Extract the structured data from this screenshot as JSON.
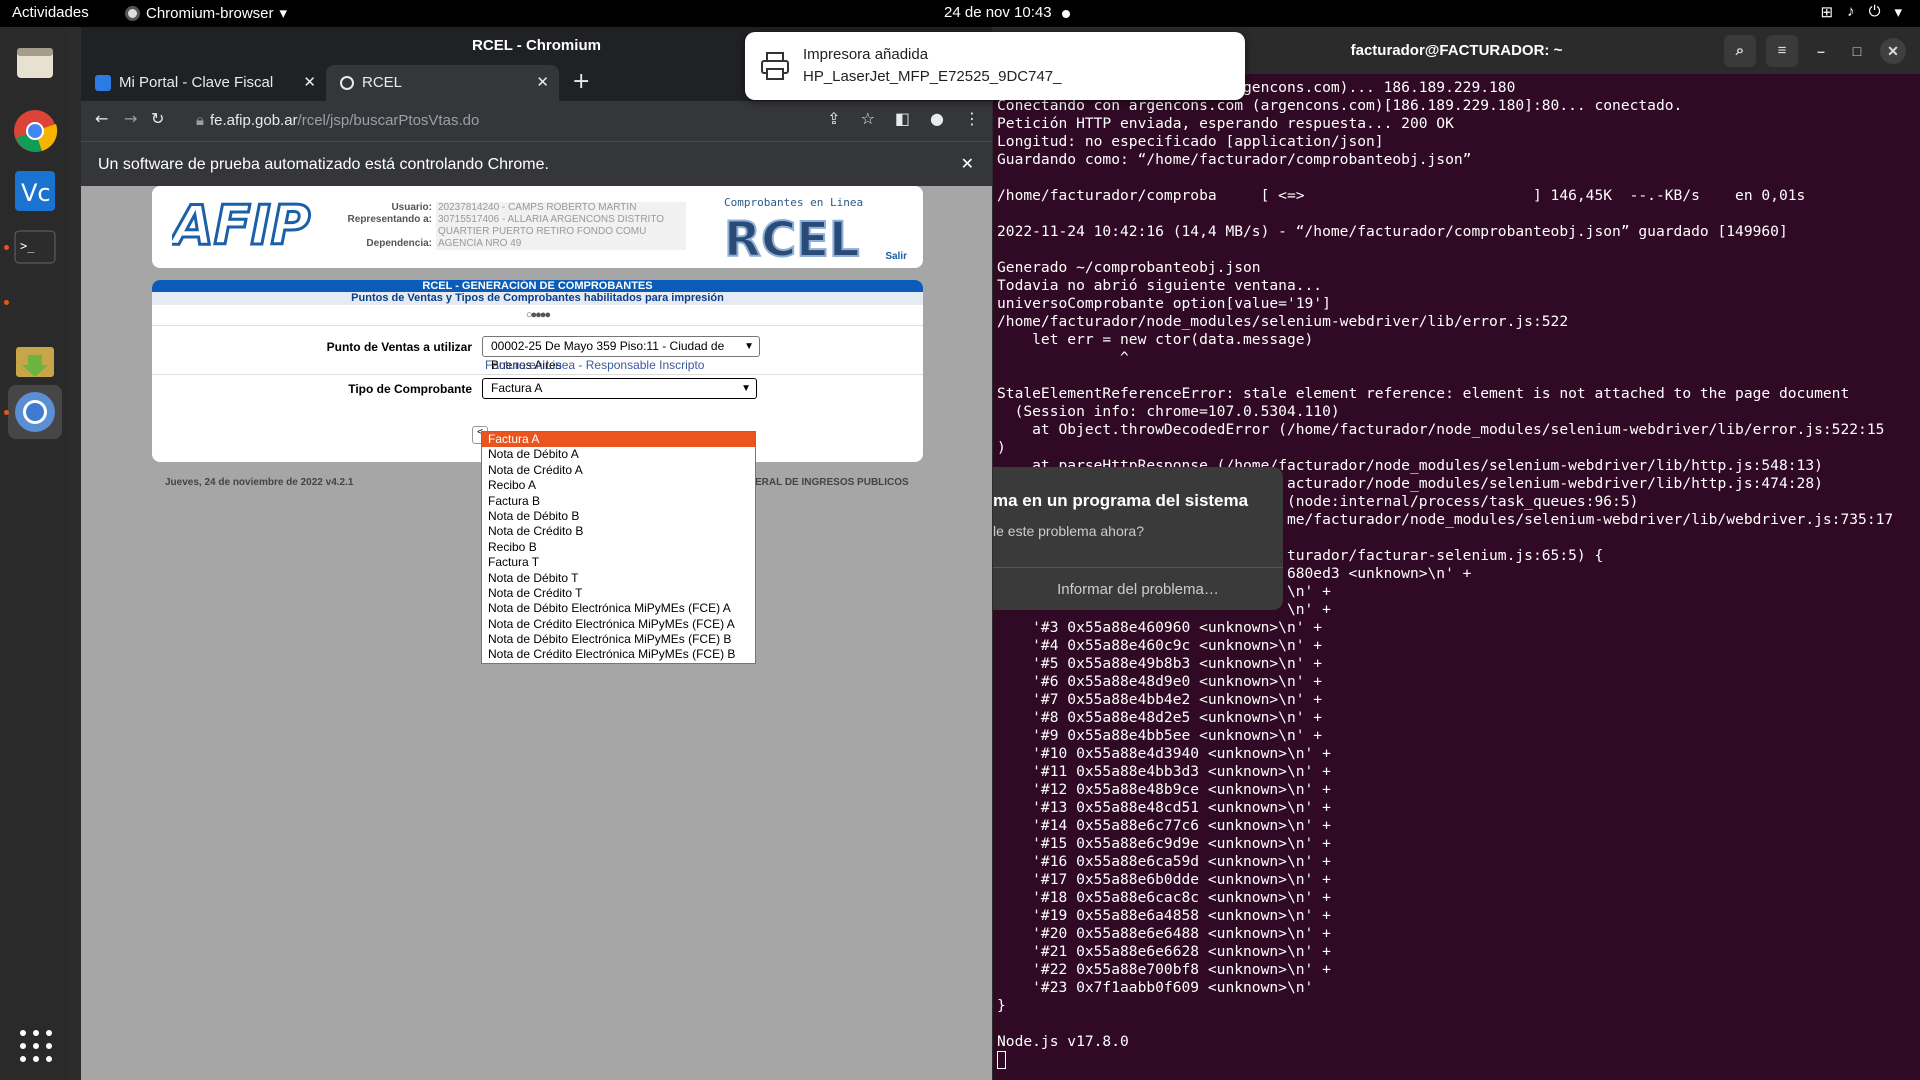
{
  "topbar": {
    "activities": "Actividades",
    "app_name": "Chromium-browser",
    "clock": "24 de nov  10:43"
  },
  "dock": {
    "items": [
      "files",
      "chrome",
      "vscode",
      "terminal",
      "archive-manager",
      "chromium"
    ]
  },
  "browser": {
    "window_title": "RCEL - Chromium",
    "tabs": [
      {
        "label": "Mi Portal - Clave Fiscal"
      },
      {
        "label": "RCEL"
      }
    ],
    "url_host": "fe.afip.gob.ar",
    "url_path": "/rcel/jsp/buscarPtosVtas.do",
    "infobar": "Un software de prueba automatizado está controlando Chrome."
  },
  "afip": {
    "logo_text": "AFIP",
    "user_label": "Usuario:",
    "user_value": "20237814240 - CAMPS ROBERTO MARTIN",
    "rep_label": "Representando a:",
    "rep_value1": "30715517406 - ALLARIA ARGENCONS DISTRITO",
    "rep_value2": "QUARTIER PUERTO RETIRO FONDO COMU",
    "dep_label": "Dependencia:",
    "dep_value": "AGENCIA NRO 49",
    "rcel_sub": "Comprobantes en Linea",
    "rcel_logo": "RCEL",
    "salir": "Salir"
  },
  "form": {
    "band_title": "RCEL - GENERACIÓN DE COMPROBANTES",
    "band_sub": "Puntos de Ventas y Tipos de Comprobantes habilitados para impresión",
    "steps": "○●●●●",
    "pv_label": "Punto de Ventas a utilizar",
    "pv_value": "00002-25 De Mayo 359 Piso:11 - Ciudad de Buenos Aires",
    "pv_hint": "Factura en Linea - Responsable Inscripto",
    "tipo_label": "Tipo de Comprobante",
    "tipo_value": "Factura A",
    "button_fragment": "<",
    "footer_left": "Jueves, 24 de noviembre de 2022 v4.2.1",
    "footer_right": "ERAL DE INGRESOS PUBLICOS",
    "options": [
      "Factura A",
      "Nota de Débito A",
      "Nota de Crédito A",
      "Recibo A",
      "Factura B",
      "Nota de Débito B",
      "Nota de Crédito B",
      "Recibo B",
      "Factura T",
      "Nota de Débito T",
      "Nota de Crédito T",
      "Nota de Débito Electrónica MiPyMEs (FCE) A",
      "Nota de Crédito Electrónica MiPyMEs (FCE) A",
      "Nota de Débito Electrónica MiPyMEs (FCE) B",
      "Nota de Crédito Electrónica MiPyMEs (FCE) B"
    ]
  },
  "notification": {
    "title": "Impresora añadida",
    "body": "HP_LaserJet_MFP_E72525_9DC747_"
  },
  "crash": {
    "title": "ma en un programa del sistema",
    "subtitle": "le este problema ahora?",
    "button": "Informar del problema…"
  },
  "terminal": {
    "title": "facturador@FACTURADOR: ~",
    "lines": [
      "                           rgencons.com)... 186.189.229.180",
      "Conectando con argencons.com (argencons.com)[186.189.229.180]:80... conectado.",
      "Petición HTTP enviada, esperando respuesta... 200 OK",
      "Longitud: no especificado [application/json]",
      "Guardando como: “/home/facturador/comprobanteobj.json”",
      "",
      "/home/facturador/comproba     [ <=>                          ] 146,45K  --.-KB/s    en 0,01s",
      "",
      "2022-11-24 10:42:16 (14,4 MB/s) - “/home/facturador/comprobanteobj.json” guardado [149960]",
      "",
      "Generado ~/comprobanteobj.json",
      "Todavia no abrió siguiente ventana...",
      "universoComprobante option[value='19']",
      "/home/facturador/node_modules/selenium-webdriver/lib/error.js:522",
      "    let err = new ctor(data.message)",
      "              ^",
      "",
      "StaleElementReferenceError: stale element reference: element is not attached to the page document",
      "  (Session info: chrome=107.0.5304.110)",
      "    at Object.throwDecodedError (/home/facturador/node_modules/selenium-webdriver/lib/error.js:522:15",
      ")",
      "    at parseHttpResponse (/home/facturador/node_modules/selenium-webdriver/lib/http.js:548:13)",
      "                                 acturador/node_modules/selenium-webdriver/lib/http.js:474:28)",
      "                                 (node:internal/process/task_queues:96:5)",
      "                                 me/facturador/node_modules/selenium-webdriver/lib/webdriver.js:735:17",
      "",
      "                                 turador/facturar-selenium.js:65:5) {",
      "                                 680ed3 <unknown>\\n' +",
      "                                 \\n' +",
      "                                 \\n' +",
      "    '#3 0x55a88e460960 <unknown>\\n' +",
      "    '#4 0x55a88e460c9c <unknown>\\n' +",
      "    '#5 0x55a88e49b8b3 <unknown>\\n' +",
      "    '#6 0x55a88e48d9e0 <unknown>\\n' +",
      "    '#7 0x55a88e4bb4e2 <unknown>\\n' +",
      "    '#8 0x55a88e48d2e5 <unknown>\\n' +",
      "    '#9 0x55a88e4bb5ee <unknown>\\n' +",
      "    '#10 0x55a88e4d3940 <unknown>\\n' +",
      "    '#11 0x55a88e4bb3d3 <unknown>\\n' +",
      "    '#12 0x55a88e48b9ce <unknown>\\n' +",
      "    '#13 0x55a88e48cd51 <unknown>\\n' +",
      "    '#14 0x55a88e6c77c6 <unknown>\\n' +",
      "    '#15 0x55a88e6c9d9e <unknown>\\n' +",
      "    '#16 0x55a88e6ca59d <unknown>\\n' +",
      "    '#17 0x55a88e6b0dde <unknown>\\n' +",
      "    '#18 0x55a88e6cac8c <unknown>\\n' +",
      "    '#19 0x55a88e6a4858 <unknown>\\n' +",
      "    '#20 0x55a88e6e6488 <unknown>\\n' +",
      "    '#21 0x55a88e6e6628 <unknown>\\n' +",
      "    '#22 0x55a88e700bf8 <unknown>\\n' +",
      "    '#23 0x7f1aabb0f609 <unknown>\\n'",
      "}",
      "",
      "Node.js v17.8.0"
    ]
  }
}
